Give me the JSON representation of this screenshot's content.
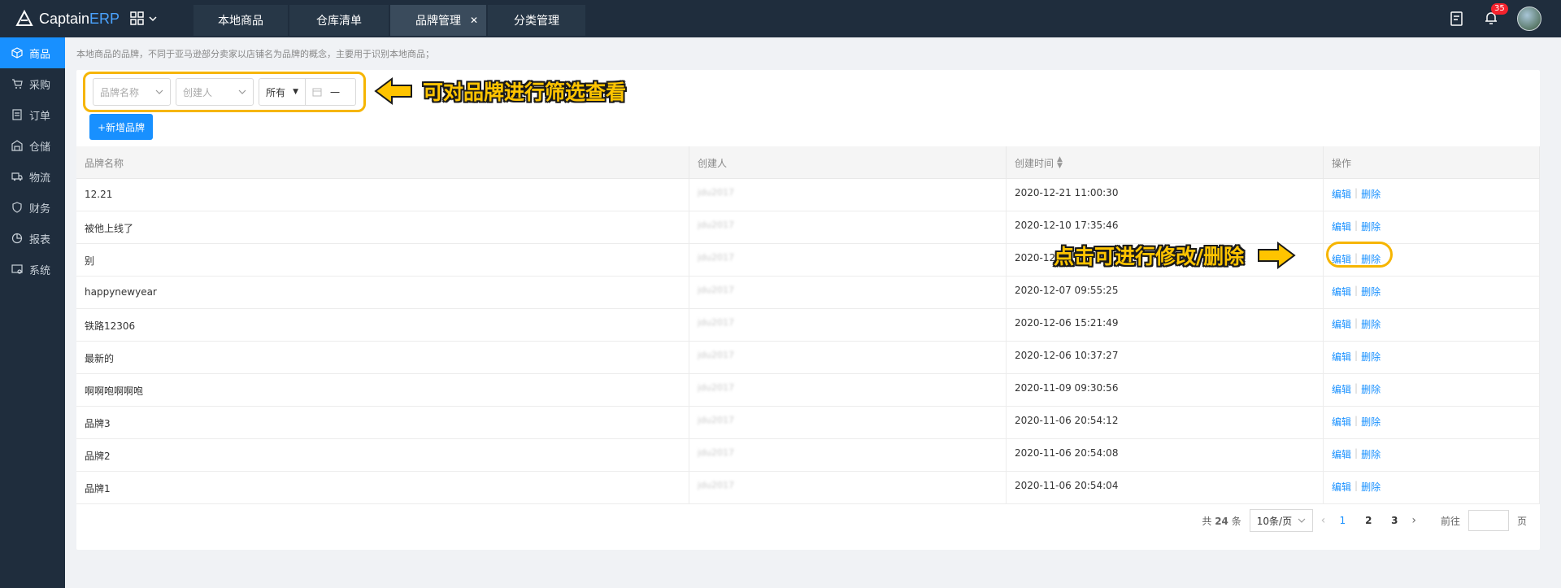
{
  "header": {
    "logo_main": "Captain",
    "logo_accent": "ERP",
    "tabs": [
      {
        "label": "本地商品"
      },
      {
        "label": "仓库清单"
      },
      {
        "label": "品牌管理"
      },
      {
        "label": "分类管理"
      }
    ],
    "notification_count": "35"
  },
  "sidebar": {
    "items": [
      {
        "label": "商品",
        "icon": "cube-icon"
      },
      {
        "label": "采购",
        "icon": "cart-icon"
      },
      {
        "label": "订单",
        "icon": "document-icon"
      },
      {
        "label": "仓储",
        "icon": "warehouse-icon"
      },
      {
        "label": "物流",
        "icon": "truck-icon"
      },
      {
        "label": "财务",
        "icon": "shield-icon"
      },
      {
        "label": "报表",
        "icon": "chart-icon"
      },
      {
        "label": "系统",
        "icon": "settings-icon"
      }
    ]
  },
  "main": {
    "hint": "本地商品的品牌，不同于亚马逊部分卖家以店铺名为品牌的概念，主要用于识别本地商品；",
    "filters": {
      "brand_placeholder": "品牌名称",
      "creator_placeholder": "创建人",
      "scope_value": "所有",
      "date_sep": "一"
    },
    "add_button": "+新增品牌",
    "annotations": {
      "filter_note": "可对品牌进行筛选查看",
      "edit_note": "点击可进行修改/删除"
    },
    "columns": [
      "品牌名称",
      "创建人",
      "创建时间",
      "操作"
    ],
    "edit_label": "编辑",
    "delete_label": "删除",
    "rows": [
      {
        "name": "12.21",
        "creator": "jdu2017",
        "time": "2020-12-21 11:00:30"
      },
      {
        "name": "被他上线了",
        "creator": "jdu2017",
        "time": "2020-12-10 17:35:46"
      },
      {
        "name": "别",
        "creator": "jdu2017",
        "time": "2020-12"
      },
      {
        "name": "happynewyear",
        "creator": "jdu2017",
        "time": "2020-12-07 09:55:25"
      },
      {
        "name": "铁路12306",
        "creator": "jdu2017",
        "time": "2020-12-06 15:21:49"
      },
      {
        "name": "最新的",
        "creator": "jdu2017",
        "time": "2020-12-06 10:37:27"
      },
      {
        "name": "啊啊咆啊啊咆",
        "creator": "jdu2017",
        "time": "2020-11-09 09:30:56"
      },
      {
        "name": "品牌3",
        "creator": "jdu2017",
        "time": "2020-11-06 20:54:12"
      },
      {
        "name": "品牌2",
        "creator": "jdu2017",
        "time": "2020-11-06 20:54:08"
      },
      {
        "name": "品牌1",
        "creator": "jdu2017",
        "time": "2020-11-06 20:54:04"
      }
    ],
    "pagination": {
      "total_prefix": "共",
      "total": "24",
      "total_suffix": "条",
      "page_size": "10条/页",
      "pages": [
        "1",
        "2",
        "3"
      ],
      "goto_label": "前往",
      "goto_suffix": "页"
    }
  },
  "colors": {
    "accent": "#1890ff",
    "highlight": "#f6b500",
    "sidebar": "#1f2d3d"
  }
}
